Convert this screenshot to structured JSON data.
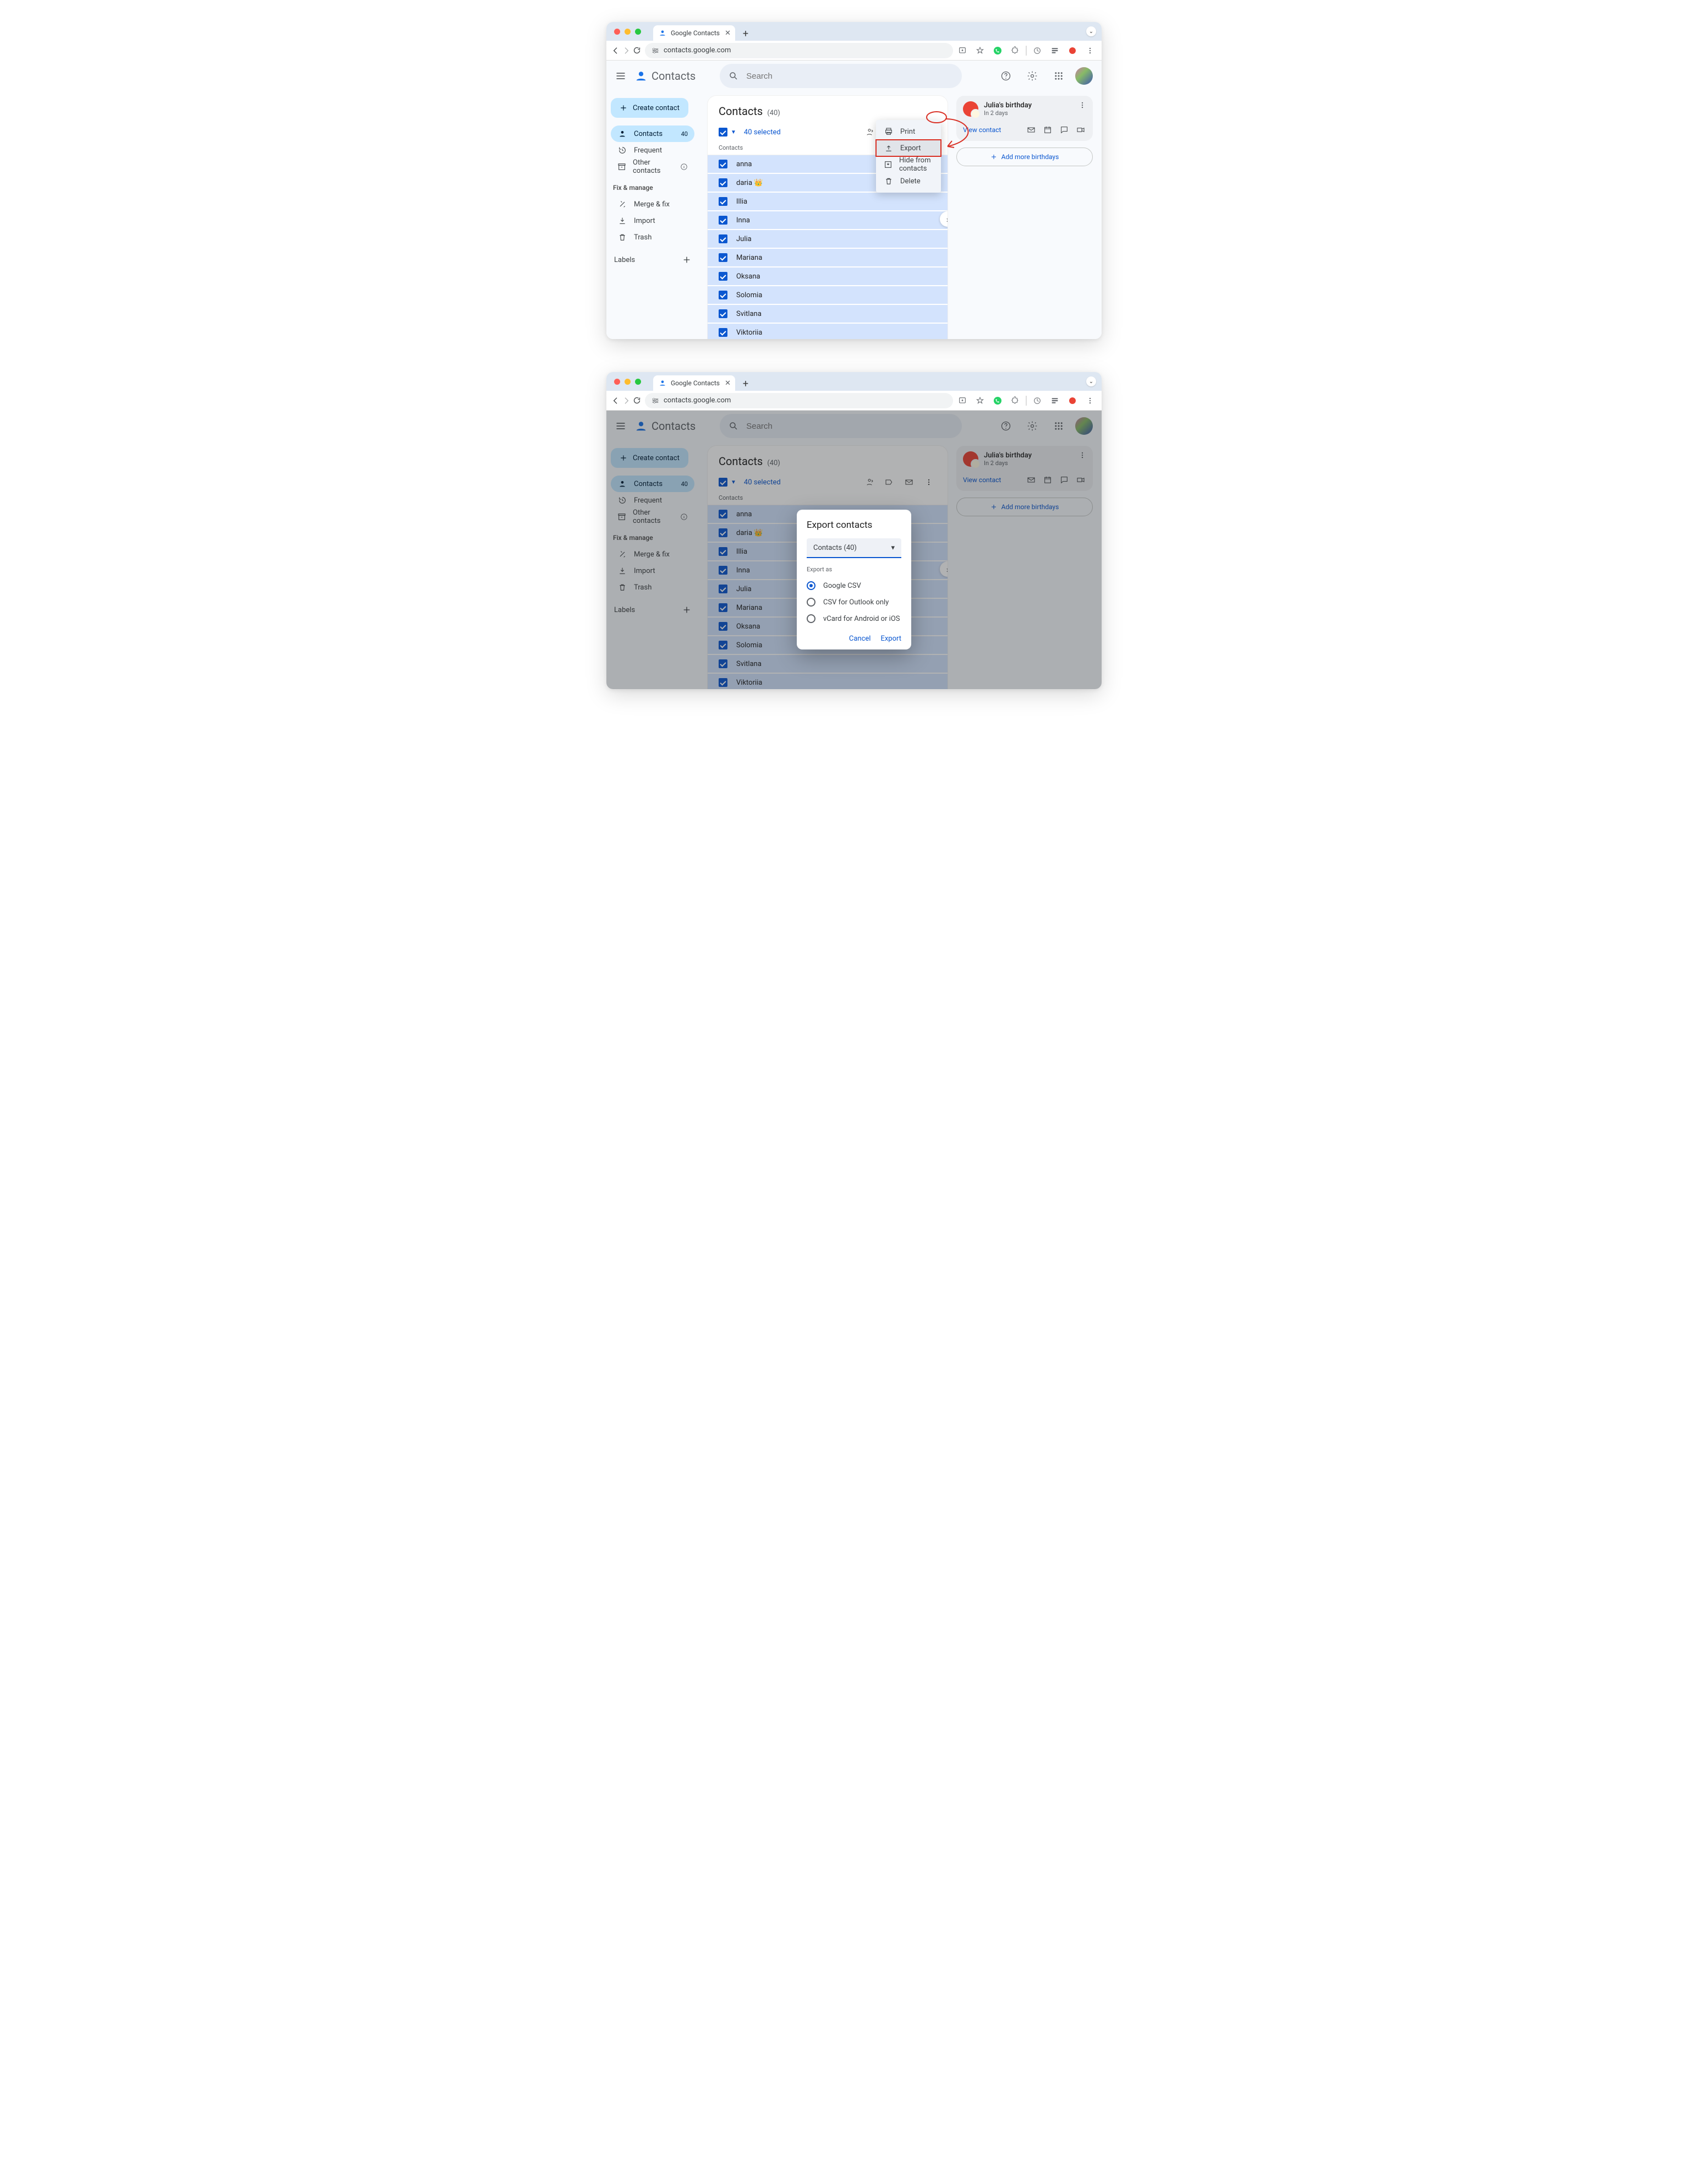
{
  "browser": {
    "tab_title": "Google Contacts",
    "url": "contacts.google.com",
    "traffic_colors": [
      "#ff5f57",
      "#febc2e",
      "#28c840"
    ]
  },
  "appbar": {
    "product": "Contacts",
    "search_placeholder": "Search"
  },
  "sidebar": {
    "create_label": "Create contact",
    "items": [
      {
        "icon": "person",
        "label": "Contacts",
        "badge": "40",
        "active": true
      },
      {
        "icon": "history",
        "label": "Frequent"
      },
      {
        "icon": "archive",
        "label": "Other contacts",
        "info": true
      }
    ],
    "fix_heading": "Fix & manage",
    "fix_items": [
      {
        "icon": "tools",
        "label": "Merge & fix"
      },
      {
        "icon": "download",
        "label": "Import"
      },
      {
        "icon": "trash",
        "label": "Trash"
      }
    ],
    "labels_heading": "Labels"
  },
  "list": {
    "title": "Contacts",
    "count_label": "(40)",
    "selected_label": "40 selected",
    "column_header": "Contacts",
    "rows": [
      "anna",
      "daria 👑",
      "Illia",
      "Inna",
      "Julia",
      "Mariana",
      "Oksana",
      "Solomia",
      "Svitlana",
      "Viktoriia"
    ]
  },
  "dropdown": {
    "items": [
      {
        "icon": "print",
        "label": "Print"
      },
      {
        "icon": "upload",
        "label": "Export"
      },
      {
        "icon": "hide",
        "label": "Hide from contacts"
      },
      {
        "icon": "trash",
        "label": "Delete"
      }
    ],
    "highlight_index": 1
  },
  "birthday": {
    "title": "Julia's birthday",
    "subtitle": "In 2 days",
    "view_label": "View contact",
    "add_label": "Add more birthdays"
  },
  "dialog": {
    "title": "Export contacts",
    "select_value": "Contacts (40)",
    "section_label": "Export as",
    "options": [
      "Google CSV",
      "CSV for Outlook only",
      "vCard for Android or iOS"
    ],
    "selected_option": 0,
    "cancel": "Cancel",
    "export": "Export"
  }
}
